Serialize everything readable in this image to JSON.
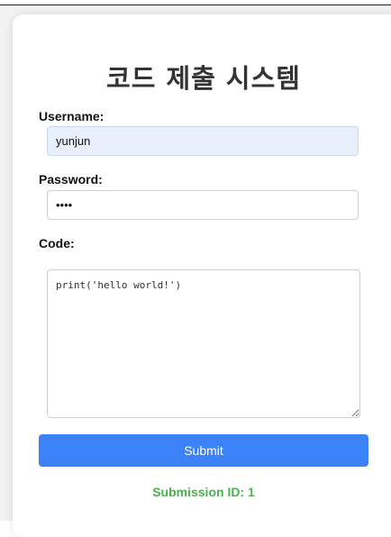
{
  "form": {
    "title": "코드 제출 시스템",
    "username_label": "Username:",
    "username_value": "yunjun",
    "password_label": "Password:",
    "password_value": "1234",
    "code_label": "Code:",
    "code_value": "print('hello world!')",
    "submit_label": "Submit"
  },
  "result": {
    "text": "Submission ID: 1"
  },
  "colors": {
    "accent": "#3b82f6",
    "success": "#4caf50",
    "autofill": "#e8f0fe"
  }
}
